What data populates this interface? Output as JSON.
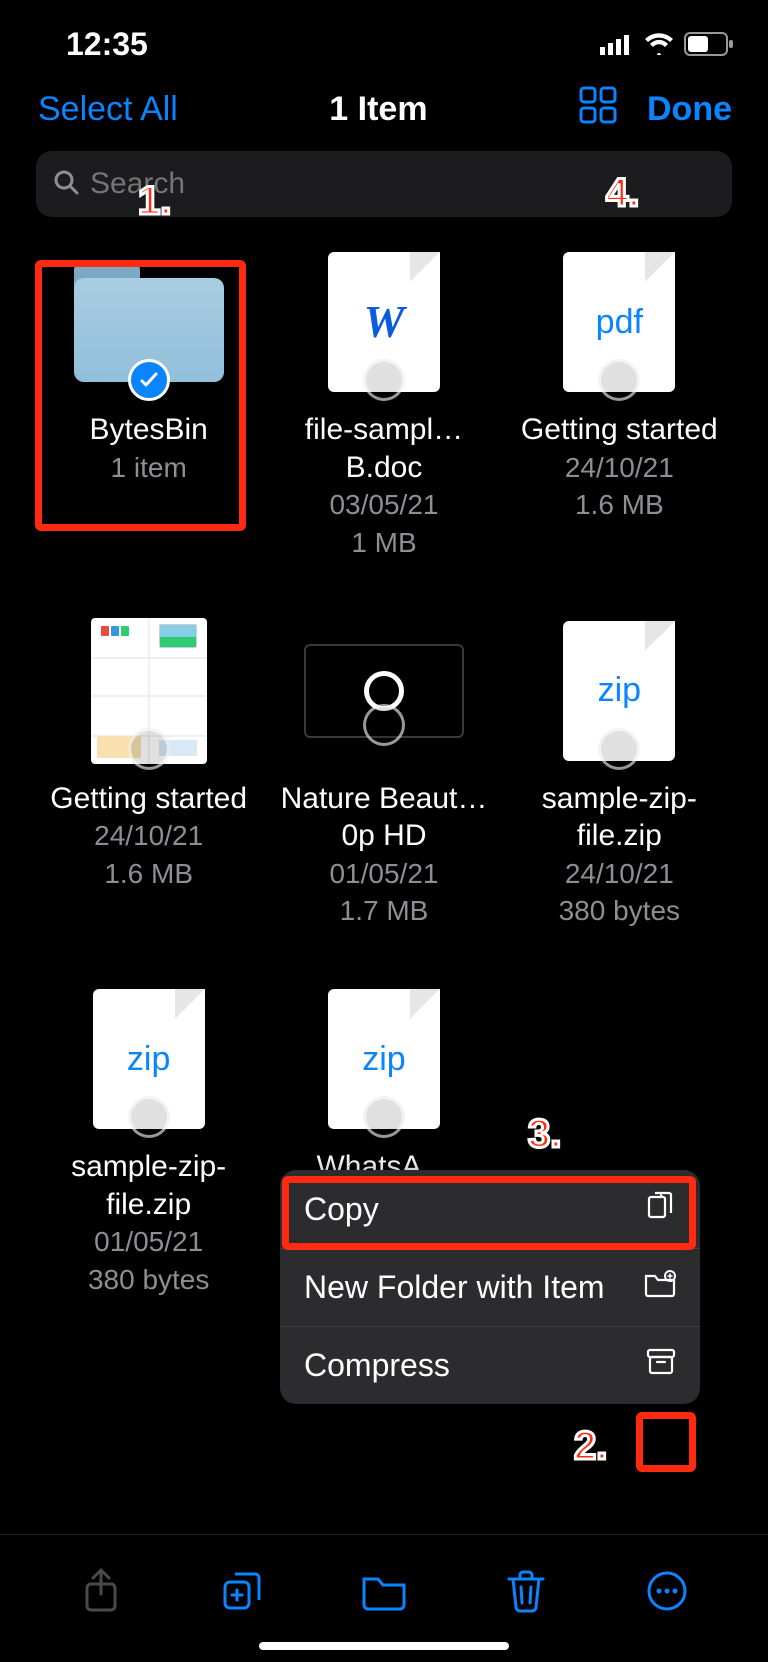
{
  "status": {
    "time": "12:35"
  },
  "nav": {
    "select_all": "Select All",
    "title": "1 Item",
    "done": "Done"
  },
  "search": {
    "placeholder": "Search"
  },
  "files": [
    {
      "name": "BytesBin",
      "meta1": "1 item",
      "meta2": "",
      "kind": "folder",
      "selected": true
    },
    {
      "name": "file-sampl…B.doc",
      "meta1": "03/05/21",
      "meta2": "1 MB",
      "kind": "word"
    },
    {
      "name": "Getting started",
      "meta1": "24/10/21",
      "meta2": "1.6 MB",
      "kind": "pdf"
    },
    {
      "name": "Getting started",
      "meta1": "24/10/21",
      "meta2": "1.6 MB",
      "kind": "rtf"
    },
    {
      "name": "Nature Beaut…0p HD",
      "meta1": "01/05/21",
      "meta2": "1.7 MB",
      "kind": "video"
    },
    {
      "name": "sample-zip-file.zip",
      "meta1": "24/10/21",
      "meta2": "380 bytes",
      "kind": "zip"
    },
    {
      "name": "sample-zip-file.zip",
      "meta1": "01/05/21",
      "meta2": "380 bytes",
      "kind": "zip"
    },
    {
      "name": "WhatsA…",
      "meta1": "",
      "meta2": "",
      "kind": "zip"
    }
  ],
  "menu": {
    "copy": "Copy",
    "new_folder": "New Folder with Item",
    "compress": "Compress"
  },
  "callouts": {
    "c1": "1.",
    "c2": "2.",
    "c3": "3.",
    "c4": "4."
  }
}
